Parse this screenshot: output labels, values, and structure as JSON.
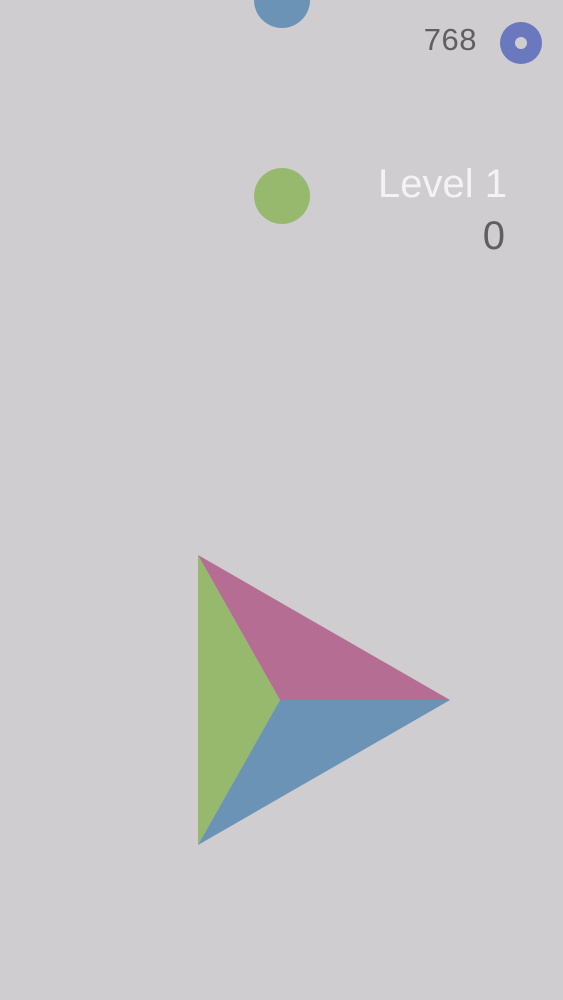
{
  "hud": {
    "coins": "768",
    "coin_icon": "coin-ring-icon",
    "level_label": "Level 1",
    "score": "0"
  },
  "colors": {
    "background": "#cfcdcf",
    "blue": "#6b93b6",
    "green": "#96b96e",
    "pink": "#b66d94",
    "coin": "#6a78bd",
    "text_dark": "#5f5f63",
    "text_light": "#f3f3f3"
  },
  "balls": [
    {
      "color": "blue"
    },
    {
      "color": "green"
    }
  ],
  "shooter": {
    "segments": [
      "green",
      "pink",
      "blue"
    ]
  }
}
